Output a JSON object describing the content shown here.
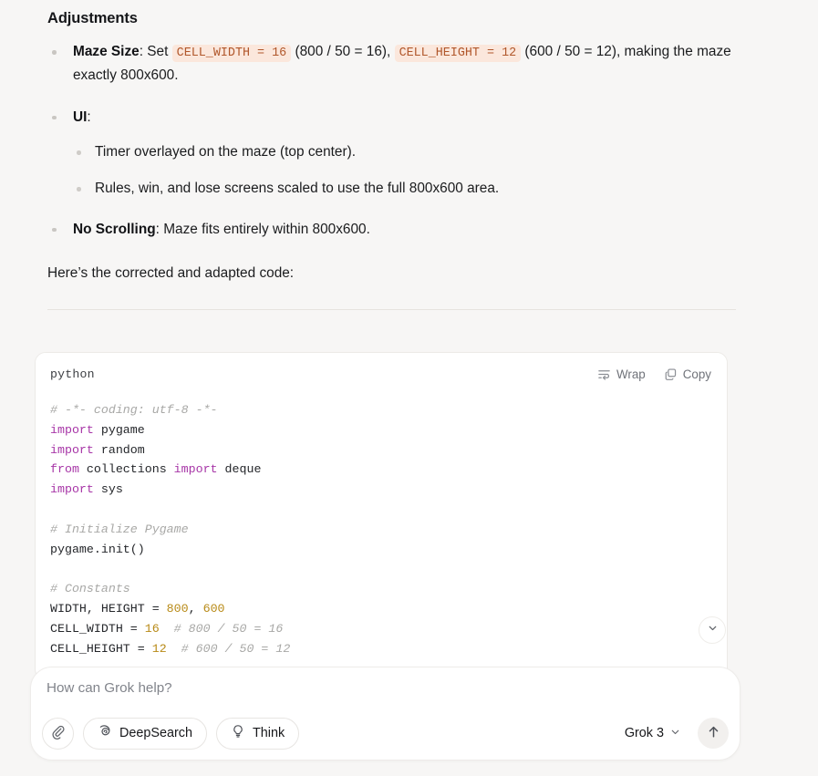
{
  "message": {
    "section_heading": "Adjustments",
    "bullets": [
      {
        "lead": "Maze Size",
        "text_1": ": Set ",
        "code_1": "CELL_WIDTH = 16",
        "text_2": " (800 / 50 = 16), ",
        "code_2": "CELL_HEIGHT = 12",
        "text_3": " (600 / 50 = 12), making the maze exactly 800x600."
      },
      {
        "lead": "UI",
        "text_1": ":",
        "sub": [
          "Timer overlayed on the maze (top center).",
          "Rules, win, and lose screens scaled to use the full 800x600 area."
        ]
      },
      {
        "lead": "No Scrolling",
        "text_1": ": Maze fits entirely within 800x600."
      }
    ],
    "closing_paragraph": "Here’s the corrected and adapted code:"
  },
  "code_block": {
    "language": "python",
    "wrap_label": "Wrap",
    "copy_label": "Copy",
    "lines": [
      "# -*- coding: utf-8 -*-",
      "import pygame",
      "import random",
      "from collections import deque",
      "import sys",
      "",
      "# Initialize Pygame",
      "pygame.init()",
      "",
      "# Constants",
      "WIDTH, HEIGHT = 800, 600",
      "CELL_WIDTH = 16  # 800 / 50 = 16",
      "CELL_HEIGHT = 12  # 600 / 50 = 12"
    ]
  },
  "composer": {
    "placeholder": "How can Grok help?",
    "deepsearch_label": "DeepSearch",
    "think_label": "Think",
    "model_label": "Grok 3"
  },
  "colors": {
    "page_background": "#f7f6f5",
    "card_background": "#ffffff",
    "inline_code_background": "#fbe7dc",
    "inline_code_text": "#b1572b",
    "keyword": "#a736a7",
    "number": "#b88a17",
    "comment": "#a8a8a6",
    "muted_text": "#70737a"
  }
}
